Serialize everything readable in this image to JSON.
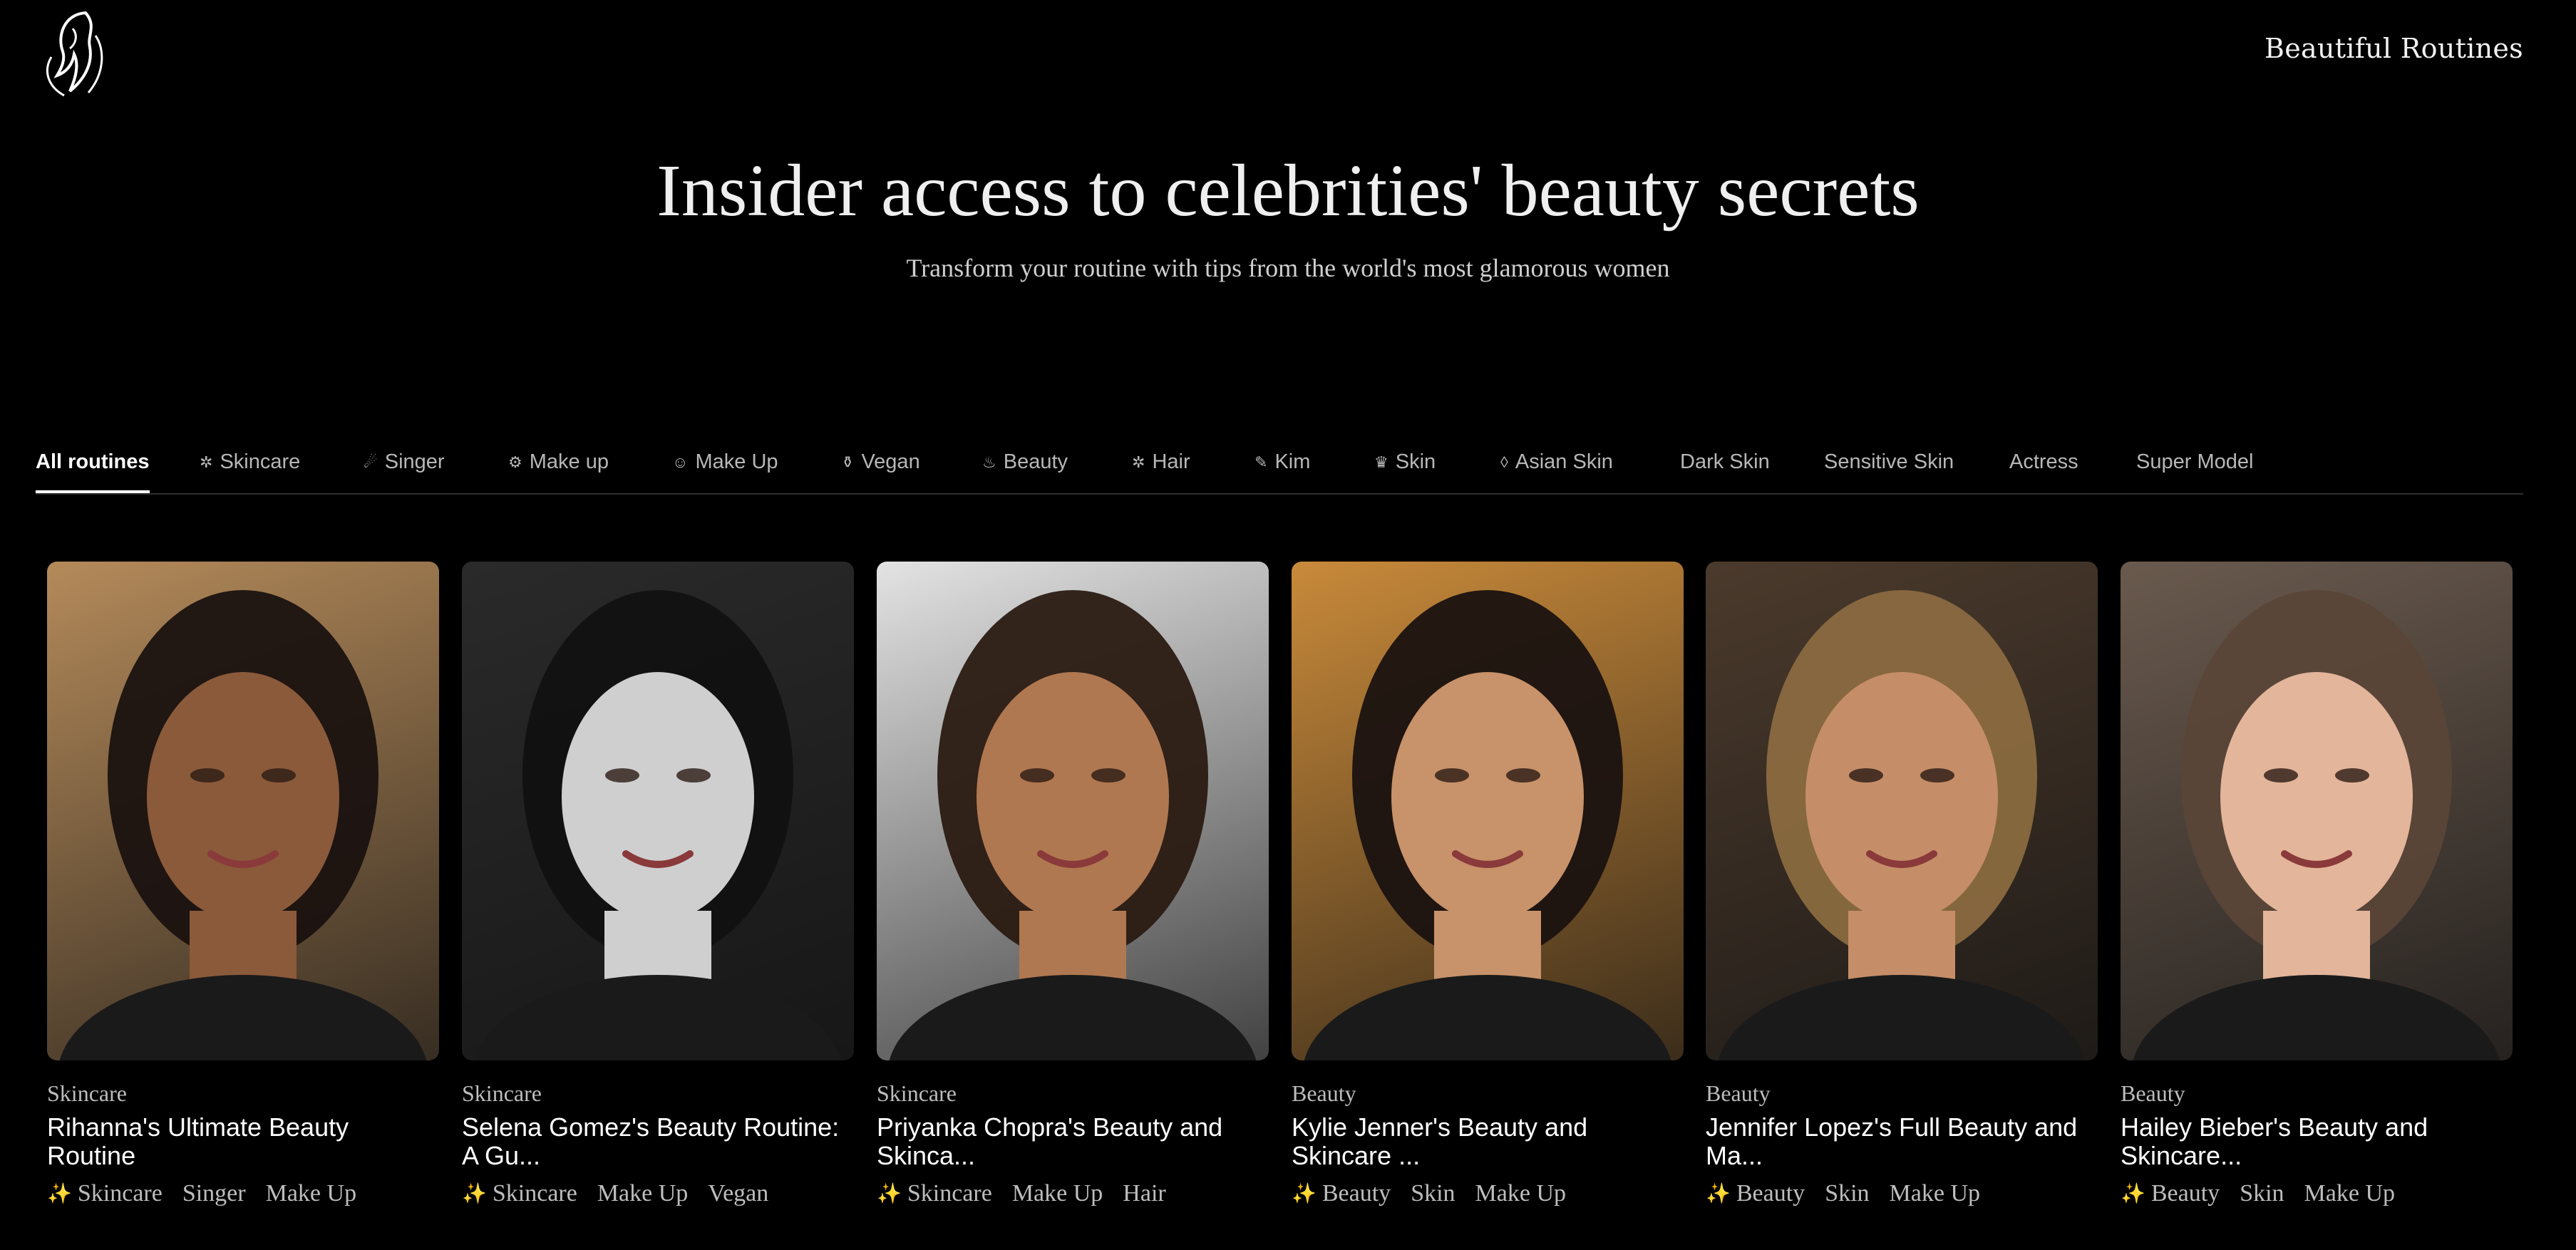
{
  "header": {
    "brand": "Beautiful Routines",
    "logo_icon": "woman-silhouette-icon"
  },
  "hero": {
    "title": "Insider access to celebrities' beauty secrets",
    "subtitle": "Transform your routine with tips from the world's most glamorous women"
  },
  "tabs": [
    {
      "label": "All routines",
      "icon": "",
      "active": true
    },
    {
      "label": "Skincare",
      "icon": "sparkle-icon"
    },
    {
      "label": "Singer",
      "icon": "microphone-icon"
    },
    {
      "label": "Make up",
      "icon": "palette-icon"
    },
    {
      "label": "Make Up",
      "icon": "face-icon"
    },
    {
      "label": "Vegan",
      "icon": "bottle-icon"
    },
    {
      "label": "Beauty",
      "icon": "perfume-icon"
    },
    {
      "label": "Hair",
      "icon": "star-icon"
    },
    {
      "label": "Kim",
      "icon": "brush-icon"
    },
    {
      "label": "Skin",
      "icon": "crown-icon"
    },
    {
      "label": "Asian Skin",
      "icon": "drop-icon"
    },
    {
      "label": "Dark Skin",
      "icon": ""
    },
    {
      "label": "Sensitive Skin",
      "icon": ""
    },
    {
      "label": "Actress",
      "icon": ""
    },
    {
      "label": "Super Model",
      "icon": ""
    }
  ],
  "cards": [
    {
      "category": "Skincare",
      "title": "Rihanna's Ultimate Beauty Routine",
      "tags": [
        "Skincare",
        "Singer",
        "Make Up"
      ],
      "bg": "#b48a5a",
      "skin": "#8a5a3a",
      "hair": "#1a1210"
    },
    {
      "category": "Skincare",
      "title": "Selena Gomez's Beauty Routine: A Gu...",
      "tags": [
        "Skincare",
        "Make Up",
        "Vegan"
      ],
      "bg": "#2a2a2a",
      "skin": "#cfcfcf",
      "hair": "#111111"
    },
    {
      "category": "Skincare",
      "title": "Priyanka Chopra's Beauty and Skinca...",
      "tags": [
        "Skincare",
        "Make Up",
        "Hair"
      ],
      "bg": "#e3e3e3",
      "skin": "#b07850",
      "hair": "#2a1a12"
    },
    {
      "category": "Beauty",
      "title": "Kylie Jenner's Beauty and Skincare ...",
      "tags": [
        "Beauty",
        "Skin",
        "Make Up"
      ],
      "bg": "#c98a3a",
      "skin": "#c8926a",
      "hair": "#1a1210"
    },
    {
      "category": "Beauty",
      "title": "Jennifer Lopez's Full Beauty and Ma...",
      "tags": [
        "Beauty",
        "Skin",
        "Make Up"
      ],
      "bg": "#4b3a2c",
      "skin": "#c58e68",
      "hair": "#8a6a40"
    },
    {
      "category": "Beauty",
      "title": "Hailey Bieber's Beauty and Skincare...",
      "tags": [
        "Beauty",
        "Skin",
        "Make Up"
      ],
      "bg": "#6a5a4e",
      "skin": "#e3b59a",
      "hair": "#5a4638"
    }
  ]
}
